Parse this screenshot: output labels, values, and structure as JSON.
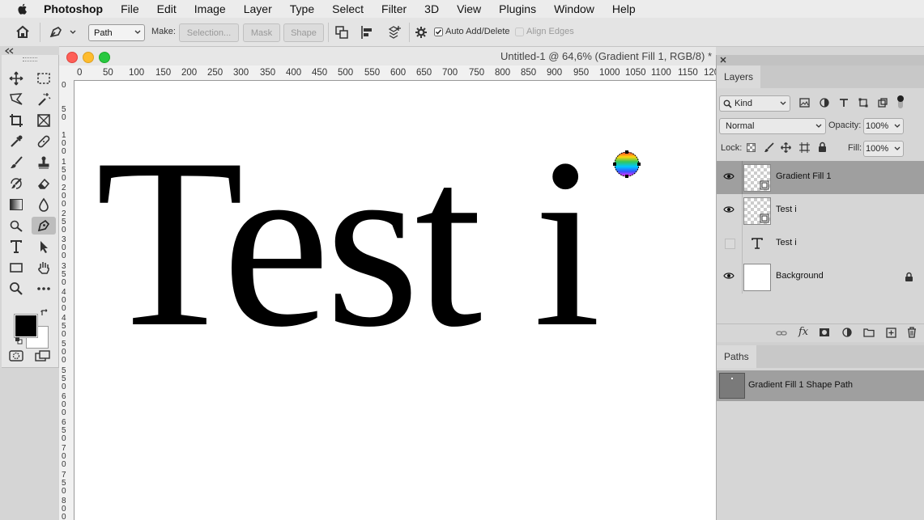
{
  "menubar": {
    "app_name": "Photoshop",
    "items": [
      "File",
      "Edit",
      "Image",
      "Layer",
      "Type",
      "Select",
      "Filter",
      "3D",
      "View",
      "Plugins",
      "Window",
      "Help"
    ]
  },
  "options_bar": {
    "mode_select": "Path",
    "make_label": "Make:",
    "selection_button": "Selection...",
    "mask_button": "Mask",
    "shape_button": "Shape",
    "auto_add_delete_label": "Auto Add/Delete",
    "auto_add_delete_checked": true,
    "align_edges_label": "Align Edges",
    "align_edges_checked": false
  },
  "document": {
    "title": "Untitled-1 @ 64,6% (Gradient Fill 1, RGB/8) *",
    "canvas_text": "Test i",
    "horizontal_ruler_ticks": [
      "0",
      "50",
      "100",
      "150",
      "200",
      "250",
      "300",
      "350",
      "400",
      "450",
      "500",
      "550",
      "600",
      "650",
      "700",
      "750",
      "800",
      "850",
      "900",
      "950",
      "1000",
      "1050",
      "1100",
      "1150",
      "120"
    ],
    "vertical_ruler_ticks": [
      "0",
      "50",
      "100",
      "150",
      "200",
      "250",
      "300",
      "350",
      "400",
      "450",
      "500",
      "550",
      "600",
      "650",
      "700",
      "750",
      "800"
    ]
  },
  "layers_panel": {
    "tab_label": "Layers",
    "filter_kind": "Kind",
    "blend_mode": "Normal",
    "opacity_label": "Opacity:",
    "opacity_value": "100%",
    "lock_label": "Lock:",
    "fill_label": "Fill:",
    "fill_value": "100%",
    "layers": [
      {
        "name": "Gradient Fill 1",
        "visible": true,
        "selected": true
      },
      {
        "name": "Test i",
        "visible": true,
        "selected": false
      },
      {
        "name": "Test i",
        "visible": false,
        "selected": false
      },
      {
        "name": "Background",
        "visible": true,
        "selected": false,
        "locked": true
      }
    ]
  },
  "paths_panel": {
    "tab_label": "Paths",
    "paths": [
      {
        "name": "Gradient Fill 1 Shape Path",
        "selected": true
      }
    ]
  },
  "colors": {
    "foreground": "#000000",
    "background": "#ffffff",
    "selection": "#9f9f9f"
  }
}
